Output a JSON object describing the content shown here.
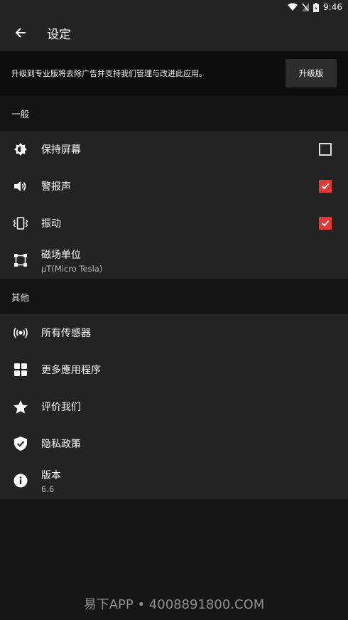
{
  "status": {
    "time": "9:46"
  },
  "appbar": {
    "title": "设定"
  },
  "promo": {
    "text": "升级到专业版将去除广告并支持我们管理与改进此应用。",
    "button": "升级版"
  },
  "general": {
    "header": "一般",
    "items": [
      {
        "label": "保持屏幕",
        "checked": false
      },
      {
        "label": "警报声",
        "checked": true
      },
      {
        "label": "振动",
        "checked": true
      },
      {
        "label": "磁场单位",
        "sub": "µT(Micro Tesla)"
      }
    ]
  },
  "other": {
    "header": "其他",
    "items": [
      {
        "label": "所有传感器"
      },
      {
        "label": "更多應用程序"
      },
      {
        "label": "评价我们"
      },
      {
        "label": "隐私政策"
      },
      {
        "label": "版本",
        "sub": "6.6"
      }
    ]
  },
  "watermark": "易下APP • 4008891800.COM",
  "colors": {
    "accent": "#e53935",
    "surface": "#232323",
    "background": "#161616"
  }
}
